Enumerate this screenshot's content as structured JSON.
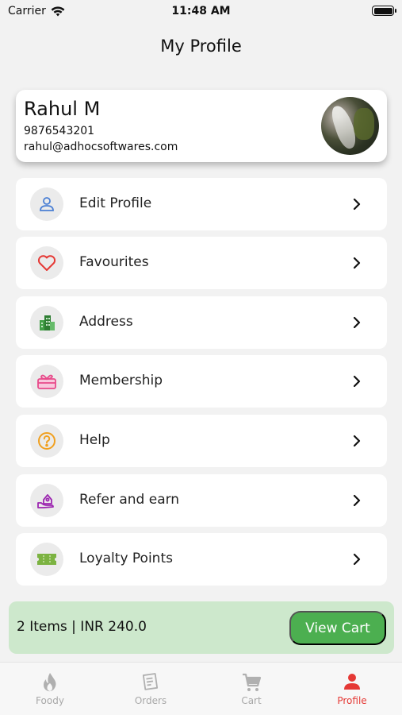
{
  "status_bar": {
    "carrier": "Carrier",
    "time": "11:48 AM"
  },
  "page_title": "My Profile",
  "profile": {
    "name": "Rahul M",
    "phone": "9876543201",
    "email": "rahul@adhocsoftwares.com"
  },
  "menu": {
    "items": [
      {
        "label": "Edit Profile",
        "icon": "user-icon",
        "color": "#4a7fd4"
      },
      {
        "label": "Favourites",
        "icon": "heart-icon",
        "color": "#e53935"
      },
      {
        "label": "Address",
        "icon": "buildings-icon",
        "color": "#43a047"
      },
      {
        "label": "Membership",
        "icon": "gift-card-icon",
        "color": "#e84a8a"
      },
      {
        "label": "Help",
        "icon": "question-icon",
        "color": "#f0a020"
      },
      {
        "label": "Refer and earn",
        "icon": "refer-icon",
        "color": "#9c27b0"
      },
      {
        "label": "Loyalty Points",
        "icon": "ticket-icon",
        "color": "#7cb342"
      }
    ]
  },
  "cart": {
    "summary": "2 Items | INR  240.0",
    "button_label": "View Cart",
    "background": "#cde8cc",
    "button_color": "#4caf50"
  },
  "tab_bar": {
    "tabs": [
      {
        "label": "Foody",
        "icon": "flame-icon"
      },
      {
        "label": "Orders",
        "icon": "orders-icon"
      },
      {
        "label": "Cart",
        "icon": "cart-icon"
      },
      {
        "label": "Profile",
        "icon": "person-icon",
        "active": true,
        "color": "#e53935"
      }
    ]
  }
}
